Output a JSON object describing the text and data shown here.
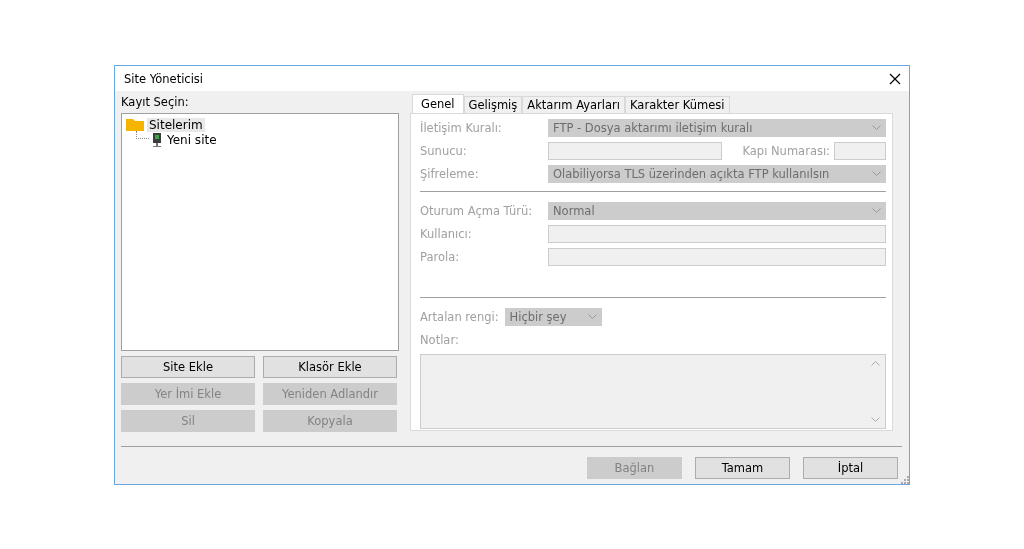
{
  "window": {
    "title": "Site Yöneticisi"
  },
  "site_list": {
    "label": "Kayıt Seçin:",
    "tree": [
      {
        "label": "Sitelerim",
        "kind": "folder",
        "selected": true,
        "children": [
          {
            "label": "Yeni site",
            "kind": "site",
            "selected": false
          }
        ]
      }
    ],
    "buttons": [
      {
        "label": "Site Ekle",
        "disabled": false
      },
      {
        "label": "Klasör Ekle",
        "disabled": false
      },
      {
        "label": "Yer İmi Ekle",
        "disabled": true
      },
      {
        "label": "Yeniden Adlandır",
        "disabled": true
      },
      {
        "label": "Sil",
        "disabled": true
      },
      {
        "label": "Kopyala",
        "disabled": true
      }
    ]
  },
  "tabs": [
    {
      "label": "Genel",
      "selected": true
    },
    {
      "label": "Gelişmiş",
      "selected": false
    },
    {
      "label": "Aktarım Ayarları",
      "selected": false
    },
    {
      "label": "Karakter Kümesi",
      "selected": false
    }
  ],
  "general": {
    "sections": [
      [
        {
          "kind": "dropdown",
          "label": "İletişim Kuralı:",
          "value": "FTP - Dosya aktarımı iletişim kuralı",
          "disabled": true
        },
        {
          "kind": "hostport",
          "label": "Sunucu:",
          "port_label": "Kapı Numarası:",
          "disabled": true
        },
        {
          "kind": "dropdown",
          "label": "Şifreleme:",
          "value": "Olabiliyorsa TLS üzerinden açıkta FTP kullanılsın",
          "disabled": true
        }
      ],
      [
        {
          "kind": "dropdown",
          "label": "Oturum Açma Türü:",
          "value": "Normal",
          "disabled": true
        },
        {
          "kind": "text",
          "label": "Kullanıcı:",
          "disabled": true
        },
        {
          "kind": "text",
          "label": "Parola:",
          "disabled": true
        }
      ],
      [
        {
          "kind": "smalldropdown",
          "label": "Artalan rengi:",
          "value": "Hiçbir şey",
          "disabled": true
        },
        {
          "kind": "textarea",
          "label": "Notlar:",
          "disabled": true
        }
      ]
    ]
  },
  "dialog_buttons": [
    {
      "label": "Bağlan",
      "disabled": true
    },
    {
      "label": "Tamam",
      "disabled": false
    },
    {
      "label": "İptal",
      "disabled": false
    }
  ]
}
